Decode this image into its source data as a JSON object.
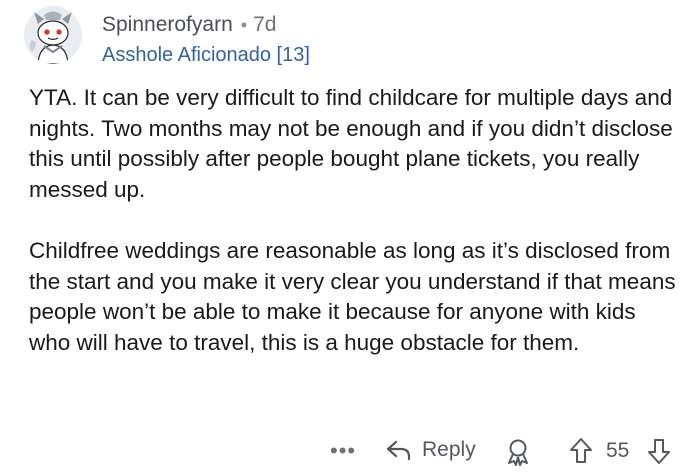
{
  "comment": {
    "author": "Spinnerofyarn",
    "separator": "•",
    "age": "7d",
    "flair": "Asshole Aficionado [13]",
    "paragraphs": [
      "YTA. It can be very difficult to find childcare for multiple days and nights. Two months may not be enough and if you didn’t disclose this until possibly after people bought plane tickets, you really messed up.",
      "Childfree weddings are reasonable as long as it’s disclosed from the start and you make it very clear you understand if that means people won’t be able to make it because for anyone with kids who will have to travel, this is a huge obstacle for them."
    ]
  },
  "actions": {
    "more": "•••",
    "reply_label": "Reply",
    "score": "55"
  },
  "icons": {
    "avatar": "snoo-avatar-icon",
    "reply": "reply-arrow-icon",
    "award": "award-icon",
    "upvote": "upvote-arrow-icon",
    "downvote": "downvote-arrow-icon"
  },
  "colors": {
    "flair": "#2f63a8",
    "text": "#1a1a1b",
    "meta": "#4b4f55"
  }
}
